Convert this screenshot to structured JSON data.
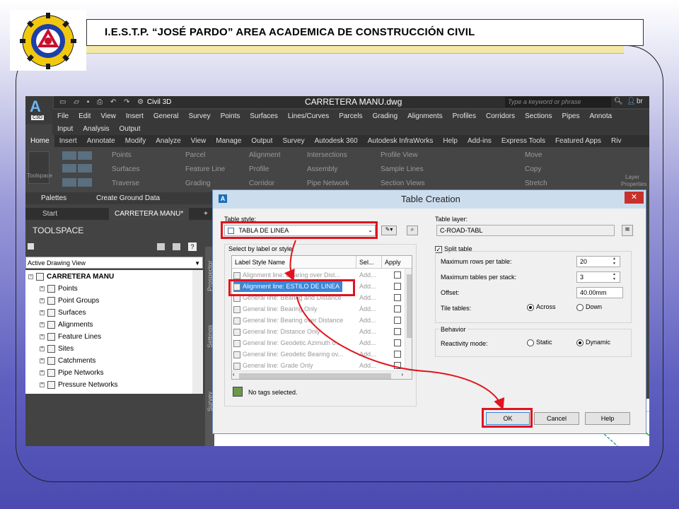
{
  "slide": {
    "title": "I.E.S.T.P. “JOSÉ PARDO” AREA ACADEMICA DE CONSTRUCCIÓN CIVIL"
  },
  "app": {
    "logo_letter": "A",
    "product_badge": "C3D",
    "workspace": "Civil 3D",
    "file_title": "CARRETERA MANU.dwg",
    "search_placeholder": "Type a keyword or phrase",
    "user_short": "br",
    "menu_row1": [
      "File",
      "Edit",
      "View",
      "Insert",
      "General",
      "Survey",
      "Points",
      "Surfaces",
      "Lines/Curves",
      "Parcels",
      "Grading",
      "Alignments",
      "Profiles",
      "Corridors",
      "Sections",
      "Pipes",
      "Annota"
    ],
    "menu_row2": [
      "Input",
      "Analysis",
      "Output"
    ],
    "ribbon_tabs": [
      "Home",
      "Insert",
      "Annotate",
      "Modify",
      "Analyze",
      "View",
      "Manage",
      "Output",
      "Survey",
      "Autodesk 360",
      "Autodesk InfraWorks",
      "Help",
      "Add-ins",
      "Express Tools",
      "Featured Apps",
      "Riv"
    ],
    "ribbon": {
      "col1": [
        "Points",
        "Surfaces",
        "Traverse"
      ],
      "col2": [
        "Parcel",
        "Feature Line",
        "Grading"
      ],
      "col3": [
        "Alignment",
        "Profile",
        "Corridor"
      ],
      "col4": [
        "Intersections",
        "Assembly",
        "Pipe Network"
      ],
      "col5": [
        "Profile View",
        "Sample Lines",
        "Section Views"
      ],
      "modify": [
        "Move",
        "Copy",
        "Stretch"
      ],
      "toolspace_label": "Toolspace",
      "layer_label": [
        "Layer",
        "Properties"
      ]
    },
    "palettes_label": "Palettes",
    "create_ground_label": "Create Ground Data",
    "doc_tabs": [
      "Start",
      "CARRETERA MANU*"
    ],
    "toolspace_title": "TOOLSPACE",
    "view_select": "Active Drawing View",
    "side_tabs": [
      "Prospector",
      "Settings",
      "Survey"
    ],
    "tree": [
      {
        "label": "CARRETERA MANU",
        "bold": true
      },
      {
        "label": "Points"
      },
      {
        "label": "Point Groups"
      },
      {
        "label": "Surfaces"
      },
      {
        "label": "Alignments"
      },
      {
        "label": "Feature Lines"
      },
      {
        "label": "Sites"
      },
      {
        "label": "Catchments"
      },
      {
        "label": "Pipe Networks"
      },
      {
        "label": "Pressure Networks"
      }
    ]
  },
  "dialog": {
    "title": "Table Creation",
    "close": "✕",
    "table_style_label": "Table style:",
    "table_style_value": "TABLA DE LINEA",
    "table_layer_label": "Table layer:",
    "table_layer_value": "C-ROAD-TABL",
    "select_label": "Select by label or style:",
    "columns": [
      "Label Style Name",
      "Sel...",
      "Apply"
    ],
    "rows": [
      {
        "name": "Alignment line: Bearing over Dist...",
        "sel": "Add..."
      },
      {
        "name": "Alignment line: ESTILO DE LINEA",
        "sel": "Add...",
        "selected": true
      },
      {
        "name": "General line: Bearing and Distance",
        "sel": "Add..."
      },
      {
        "name": "General line: Bearing Only",
        "sel": "Add..."
      },
      {
        "name": "General line: Bearing over Distance",
        "sel": "Add..."
      },
      {
        "name": "General line: Distance Only",
        "sel": "Add..."
      },
      {
        "name": "General line: Geodetic Azimuth o...",
        "sel": "Add..."
      },
      {
        "name": "General line: Geodetic Bearing ov...",
        "sel": "Add..."
      },
      {
        "name": "General line: Grade Only",
        "sel": "Add..."
      }
    ],
    "no_tags": "No tags selected.",
    "split_table": "Split table",
    "max_rows_label": "Maximum rows per table:",
    "max_rows_value": "20",
    "max_tables_label": "Maximum tables per stack:",
    "max_tables_value": "3",
    "offset_label": "Offset:",
    "offset_value": "40.00mm",
    "tile_label": "Tile tables:",
    "tile_across": "Across",
    "tile_down": "Down",
    "behavior_label": "Behavior",
    "reactivity_label": "Reactivity mode:",
    "static": "Static",
    "dynamic": "Dynamic",
    "ok": "OK",
    "cancel": "Cancel",
    "help": "Help"
  },
  "colors": {
    "highlight_red": "#e0141e",
    "selection_blue": "#3a86d9",
    "dialog_bg": "#f0f0f0"
  }
}
